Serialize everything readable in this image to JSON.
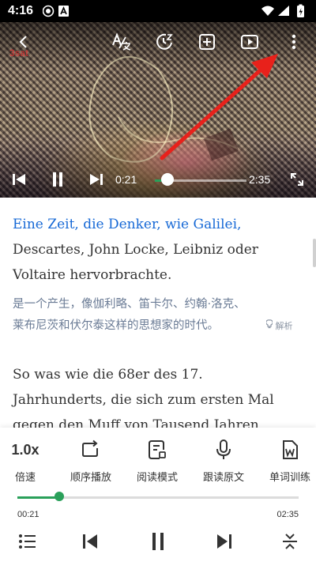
{
  "status_bar": {
    "time": "4:16"
  },
  "video": {
    "watermark": "3sat",
    "current_time": "0:21",
    "duration": "2:35",
    "progress": 0.135
  },
  "transcript": {
    "segment1": {
      "german_lines": [
        "Eine Zeit, die Denker, wie Galilei,",
        "Descartes, John Locke, Leibniz oder",
        "Voltaire hervorbrachte."
      ],
      "chinese_lines": [
        "是一个产生，像伽利略、笛卡尔、约翰·洛克、",
        "莱布尼茨和伏尔泰这样的思想家的时代。"
      ],
      "parse_label": "解析"
    },
    "segment2": {
      "german_lines": [
        "So was wie die 68er des 17.",
        "Jahrhunderts, die sich zum ersten Mal",
        "gegen den Muff von Tausend Jahren"
      ]
    }
  },
  "panel": {
    "speed_value": "1.0x",
    "speed_label": "倍速",
    "loop_label": "顺序播放",
    "read_mode_label": "阅读模式",
    "follow_read_label": "跟读原文",
    "word_training_label": "单词训练",
    "current_time": "00:21",
    "duration": "02:35",
    "progress": 0.15
  },
  "colors": {
    "accent": "#2aa05a",
    "active_text": "#1769d6",
    "annotation_arrow": "#e8211b"
  }
}
